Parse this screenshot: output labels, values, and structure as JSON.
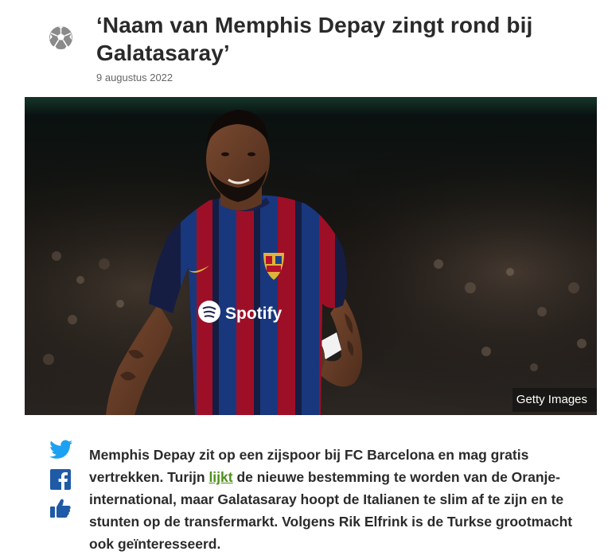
{
  "article": {
    "category_icon": "football-icon",
    "title": "‘Naam van Memphis Depay zingt rond bij Galatasaray’",
    "date": "9 augustus 2022"
  },
  "hero": {
    "credit": "Getty Images",
    "jersey_text": "Spotify",
    "jersey_colors": {
      "stripe_blue": "#1d3f8f",
      "stripe_red": "#b3122c",
      "navy": "#18214d"
    }
  },
  "share": {
    "twitter_icon": "twitter-icon",
    "facebook_icon": "facebook-icon",
    "like_icon": "thumbs-up-icon",
    "twitter_color": "#1da1f2",
    "facebook_color": "#1f5aa6"
  },
  "intro": {
    "part1": "Memphis Depay zit op een zijspoor bij FC Barcelona en mag gratis vertrekken. Turijn ",
    "link": "lijkt",
    "part2": " de nieuwe bestemming te worden van de Oranje-international, maar Galatasaray hoopt de Italianen te slim af te zijn en te stunten op de transfermarkt. Volgens Rik Elfrink is de Turkse grootmacht ook geïnteresseerd.",
    "link_color": "#4e8f1c"
  }
}
